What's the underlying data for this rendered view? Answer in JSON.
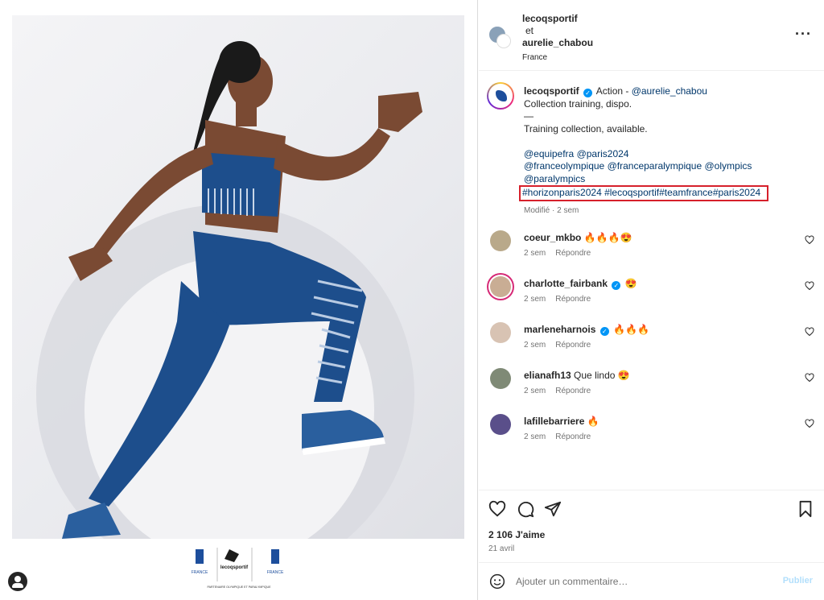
{
  "header": {
    "author1": "lecoqsportif",
    "joiner": "et",
    "author2": "aurelie_chabou",
    "location": "France",
    "more_icon": "more-horizontal-icon"
  },
  "caption": {
    "username": "lecoqsportif",
    "line1_text": "Action - ",
    "line1_mention": "@aurelie_chabou",
    "line2": "Collection training, dispo.",
    "line3": "—",
    "line4": "Training collection, available.",
    "mentions1a": "@equipefra",
    "mentions1b": "@paris2024",
    "mentions2a": "@franceolympique",
    "mentions2b": "@franceparalympique",
    "mentions2c": "@olympics",
    "mentions3": "@paralympics",
    "hashtags": "#horizonparis2024 #lecoqsportif#teamfrance#paris2024",
    "meta": "Modifié · 2 sem"
  },
  "comments": [
    {
      "user": "coeur_mkbo",
      "text": "🔥🔥🔥😍",
      "verified": false,
      "age": "2 sem",
      "reply": "Répondre",
      "avatar_color": "#b9a98a"
    },
    {
      "user": "charlotte_fairbank",
      "text": "😍",
      "verified": true,
      "age": "2 sem",
      "reply": "Répondre",
      "avatar_color": "#c9ad94"
    },
    {
      "user": "marleneharnois",
      "text": "🔥🔥🔥",
      "verified": true,
      "age": "2 sem",
      "reply": "Répondre",
      "avatar_color": "#d8c3b3"
    },
    {
      "user": "elianafh13",
      "text": "Que lindo 😍",
      "verified": false,
      "age": "2 sem",
      "reply": "Répondre",
      "avatar_color": "#7f8a76"
    },
    {
      "user": "lafillebarriere",
      "text": "🔥",
      "verified": false,
      "age": "2 sem",
      "reply": "Répondre",
      "avatar_color": "#5a4f8a"
    }
  ],
  "actions": {
    "likes": "2 106 J'aime",
    "date": "21 avril"
  },
  "add_comment": {
    "placeholder": "Ajouter un commentaire…",
    "post_label": "Publier"
  },
  "colors": {
    "accent": "#0095f6",
    "highlight_box": "#d6202b",
    "link": "#00376b",
    "outfit": "#1d4e8c"
  }
}
